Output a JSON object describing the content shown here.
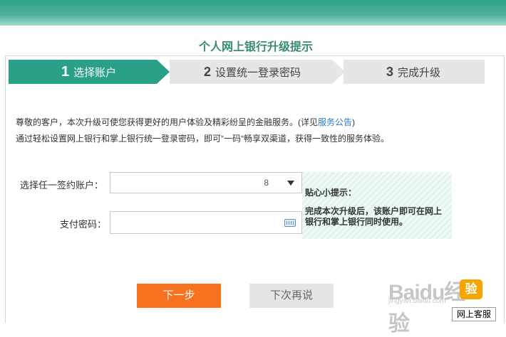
{
  "title": "个人网上银行升级提示",
  "steps": [
    {
      "num": "1",
      "label": "选择账户"
    },
    {
      "num": "2",
      "label": "设置统一登录密码"
    },
    {
      "num": "3",
      "label": "完成升级"
    }
  ],
  "intro": {
    "line1_text": "尊敬的客户，本次升级可使您获得更好的用户体验及精彩纷呈的金融服务。(详见",
    "line1_link": "服务公告",
    "line1_end": ")",
    "line2": "通过轻松设置网上银行和掌上银行统一登录密码，即可“一码“畅享双渠道，获得一致性的服务体验。"
  },
  "form": {
    "account_label": "选择任一签约账户：",
    "account_value": "8",
    "password_label": "支付密码："
  },
  "tips": {
    "title": "贴心小提示：",
    "body": "完成本次升级后，该账户即可在网上银行和掌上银行同时使用。"
  },
  "buttons": {
    "next": "下一步",
    "later": "下次再说"
  },
  "watermark": {
    "text": "Baidu经验",
    "sub": "jingyan.baidu.com",
    "badge": "验"
  },
  "service": "网上客服",
  "colors": {
    "brand_green": "#2aa089",
    "next_orange": "#f6721e",
    "link_blue": "#2b78c5"
  }
}
